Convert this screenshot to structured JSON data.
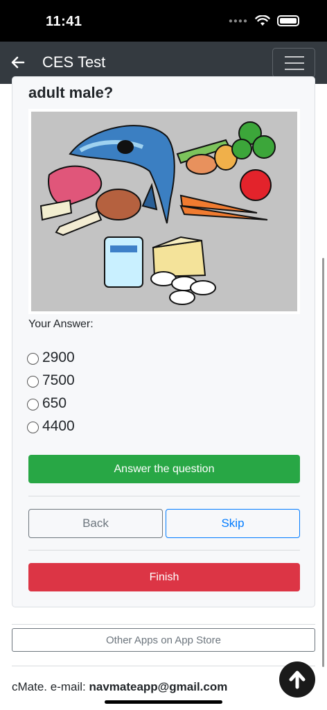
{
  "status_bar": {
    "time": "11:41"
  },
  "nav": {
    "title": "CES Test"
  },
  "question": {
    "text": "adult male?"
  },
  "answer_label": "Your Answer:",
  "options": [
    "2900",
    "7500",
    "650",
    "4400"
  ],
  "buttons": {
    "answer": "Answer the question",
    "back": "Back",
    "skip": "Skip",
    "finish": "Finish",
    "other_apps": "Other Apps on App Store"
  },
  "footer": {
    "prefix": "cMate. e-mail: ",
    "email": "navmateapp@gmail.com"
  },
  "colors": {
    "nav_bg": "#343a40",
    "success": "#28a745",
    "primary": "#007bff",
    "danger": "#dc3545",
    "secondary": "#6c757d"
  }
}
